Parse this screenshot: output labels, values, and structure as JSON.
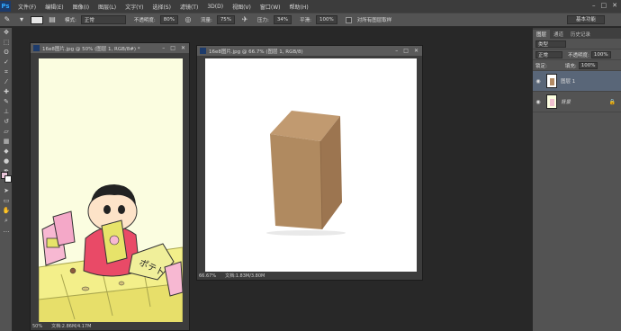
{
  "app": {
    "logo": "Ps"
  },
  "menu": [
    "文件(F)",
    "编辑(E)",
    "图像(I)",
    "图层(L)",
    "文字(Y)",
    "选择(S)",
    "滤镜(T)",
    "3D(D)",
    "视图(V)",
    "窗口(W)",
    "帮助(H)"
  ],
  "window_controls": [
    "–",
    "□",
    "✕"
  ],
  "options": {
    "mode_label": "模式:",
    "mode_value": "正常",
    "opacity_label": "不透明度:",
    "opacity_value": "80%",
    "flow_label": "流量:",
    "flow_value": "75%",
    "pressure_label": "压力:",
    "pressure_value": "34%",
    "smooth_label": "平滑:",
    "smooth_value": "100%",
    "sample_label": "对所有图层取样",
    "workspace": "基本功能"
  },
  "doc1": {
    "title": "16e8图片.jpg @ 50% (图层 1, RGB/8#) *",
    "zoom": "50%",
    "status": "文档:2.86M/4.17M"
  },
  "doc2": {
    "title": "16e8图片.jpg @ 66.7% (图层 1, RGB/8)",
    "zoom": "66.67%",
    "status": "文档:1.83M/3.80M"
  },
  "panel": {
    "tabs": [
      "图层",
      "通道",
      "历史记录"
    ],
    "filter_label": "类型",
    "blend_mode": "正常",
    "opacity_label": "不透明度:",
    "opacity_value": "100%",
    "lock_label": "锁定:",
    "fill_label": "填充:",
    "fill_value": "100%",
    "layers": [
      {
        "name": "图层 1",
        "selected": true
      },
      {
        "name": "背景",
        "selected": false
      }
    ]
  },
  "colors": {
    "foreground": "#e9c6d9",
    "background": "#ffffff",
    "canvas1_bg": "#fbfde0"
  }
}
